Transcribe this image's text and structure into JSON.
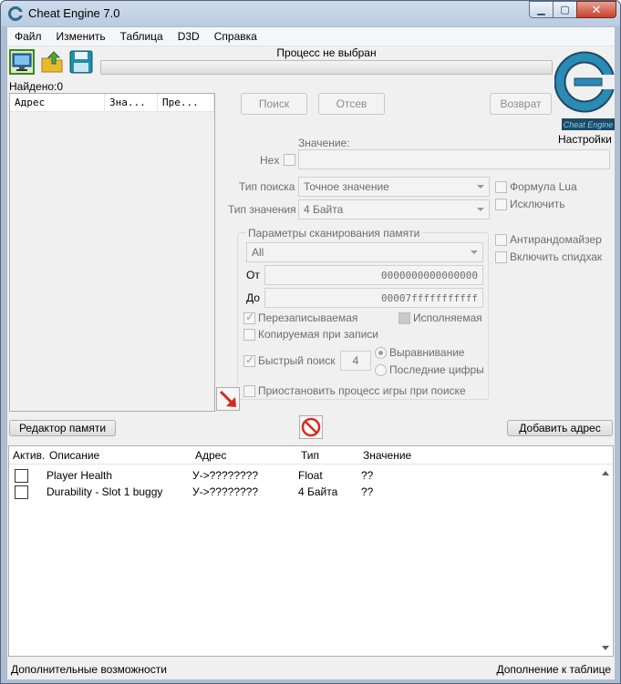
{
  "window": {
    "title": "Cheat Engine 7.0"
  },
  "menu": [
    "Файл",
    "Изменить",
    "Таблица",
    "D3D",
    "Справка"
  ],
  "toolbar": {
    "process_label": "Процесс не выбран",
    "found_label": "Найдено:0",
    "settings_label": "Настройки",
    "logo_text": "Cheat Engine"
  },
  "found_list": {
    "columns": [
      "Адрес",
      "Зна...",
      "Пре..."
    ]
  },
  "scan": {
    "first_scan_label": "Поиск",
    "next_scan_label": "Отсев",
    "undo_label": "Возврат",
    "value_label": "Значение:",
    "hex_label": "Hex",
    "scan_type_label": "Тип поиска",
    "scan_type_value": "Точное значение",
    "value_type_label": "Тип значения",
    "value_type_value": "4 Байта",
    "lua_formula_label": "Формула Lua",
    "exclude_label": "Исключить",
    "memory_scan_title": "Параметры сканирования памяти",
    "region_value": "All",
    "from_label": "От",
    "from_value": "0000000000000000",
    "to_label": "До",
    "to_value": "00007fffffffffff",
    "writable_label": "Перезаписываемая",
    "executable_label": "Исполняемая",
    "copy_on_write_label": "Копируемая при записи",
    "fast_scan_label": "Быстрый поиск",
    "fast_scan_value": "4",
    "alignment_label": "Выравнивание",
    "last_digits_label": "Последние цифры",
    "pause_label": "Приостановить процесс игры при поиске",
    "unrandomizer_label": "Антирандомайзер",
    "speedhack_label": "Включить спидхак"
  },
  "bottom_buttons": {
    "memory_view_label": "Редактор памяти",
    "add_address_label": "Добавить адрес"
  },
  "cheat_table": {
    "columns": [
      "Актив.",
      "Описание",
      "Адрес",
      "Тип",
      "Значение"
    ],
    "rows": [
      {
        "active": false,
        "description": "Player Health",
        "address": "У->????????",
        "type": "Float",
        "value": "??"
      },
      {
        "active": false,
        "description": "Durability - Slot 1 buggy",
        "address": "У->????????",
        "type": "4 Байта",
        "value": "??"
      }
    ]
  },
  "status": {
    "left": "Дополнительные возможности",
    "right": "Дополнение к таблице"
  }
}
